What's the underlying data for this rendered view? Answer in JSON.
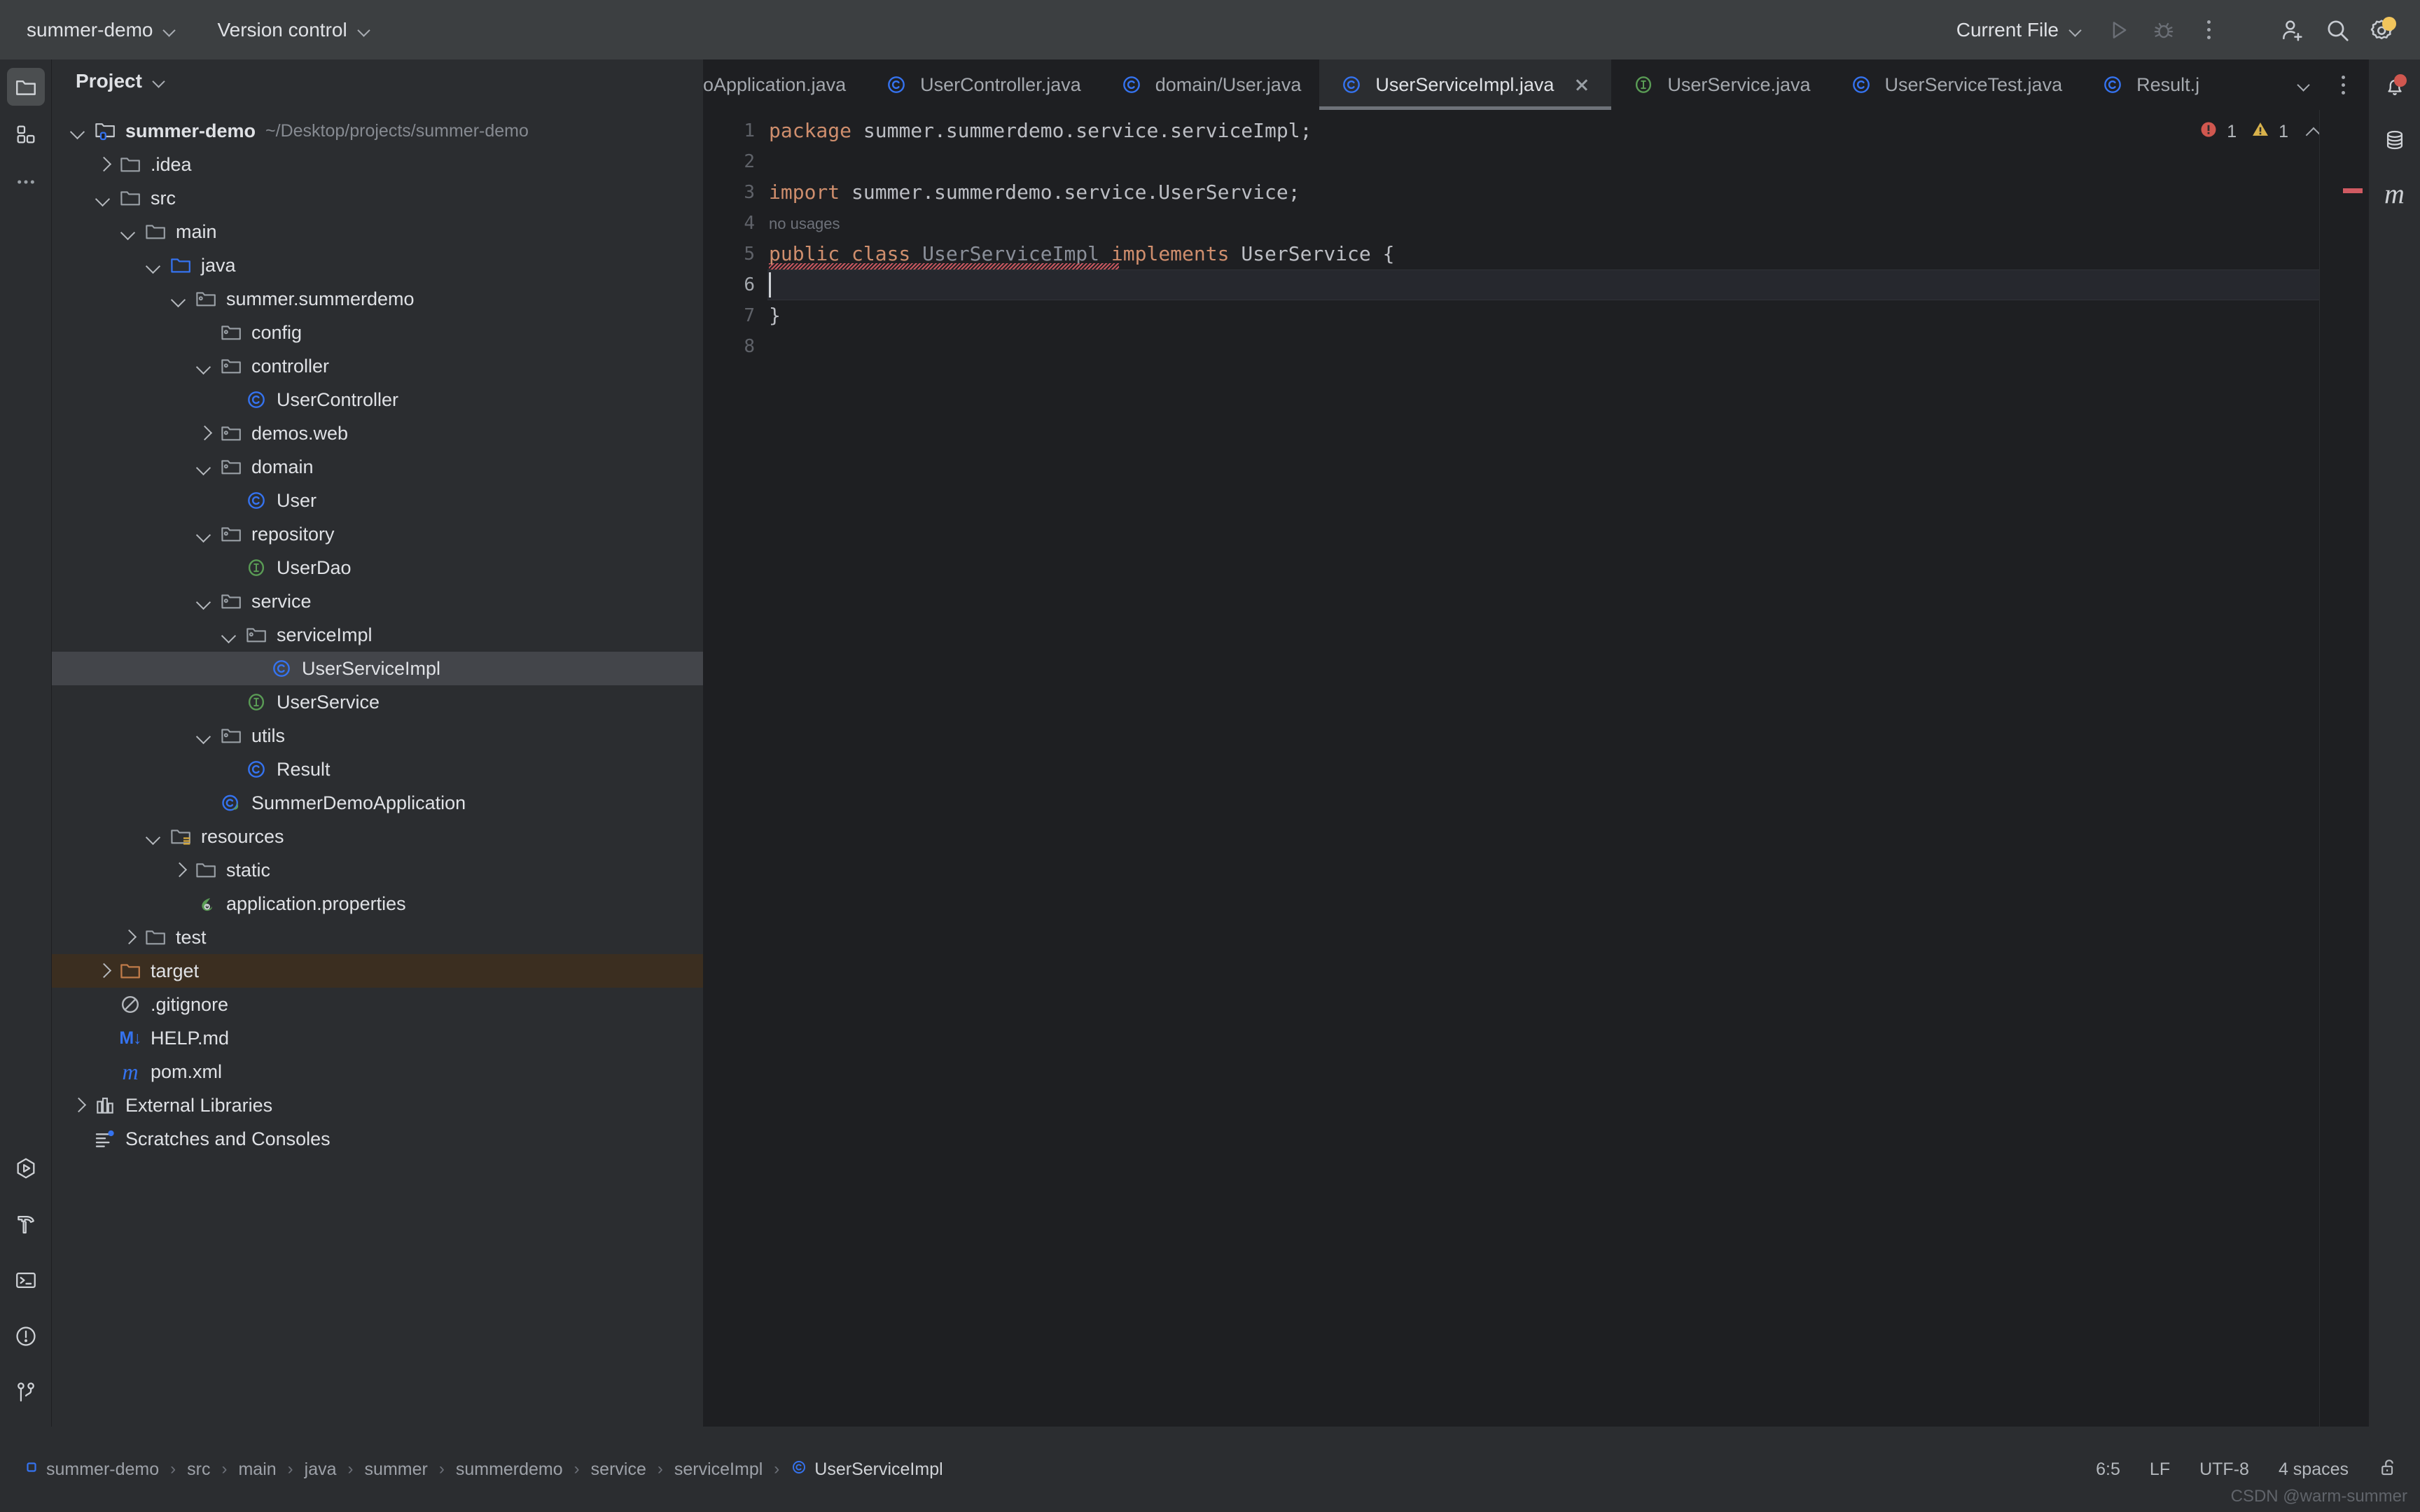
{
  "titlebar": {
    "project_menu": "summer-demo",
    "vcs_menu": "Version control",
    "run_config": "Current File",
    "icons": {
      "run": "run-icon",
      "debug": "debug-icon",
      "more": "more-vertical-icon",
      "add_user": "add-user-icon",
      "search": "search-icon",
      "settings": "settings-gear-icon"
    }
  },
  "left_rail": {
    "top": [
      "project-icon",
      "commit-icon",
      "more-tool-windows-icon"
    ],
    "bottom": [
      "run-tool-icon",
      "build-hammer-icon",
      "terminal-icon",
      "problems-icon",
      "version-control-branch-icon"
    ]
  },
  "right_rail": [
    "notifications-bell-icon",
    "database-icon",
    "maven-icon"
  ],
  "project_panel": {
    "title": "Project",
    "tree": [
      {
        "depth": 0,
        "twisty": "down",
        "icon": "module-folder",
        "label": "summer-demo",
        "bold": true,
        "path": "~/Desktop/projects/summer-demo"
      },
      {
        "depth": 1,
        "twisty": "right",
        "icon": "folder",
        "label": ".idea"
      },
      {
        "depth": 1,
        "twisty": "down",
        "icon": "folder",
        "label": "src"
      },
      {
        "depth": 2,
        "twisty": "down",
        "icon": "folder",
        "label": "main"
      },
      {
        "depth": 3,
        "twisty": "down",
        "icon": "source-folder",
        "label": "java"
      },
      {
        "depth": 4,
        "twisty": "down",
        "icon": "package",
        "label": "summer.summerdemo"
      },
      {
        "depth": 5,
        "twisty": "none",
        "icon": "package",
        "label": "config"
      },
      {
        "depth": 5,
        "twisty": "down",
        "icon": "package",
        "label": "controller"
      },
      {
        "depth": 6,
        "twisty": "none",
        "icon": "class",
        "label": "UserController"
      },
      {
        "depth": 5,
        "twisty": "right",
        "icon": "package",
        "label": "demos.web"
      },
      {
        "depth": 5,
        "twisty": "down",
        "icon": "package",
        "label": "domain"
      },
      {
        "depth": 6,
        "twisty": "none",
        "icon": "class",
        "label": "User"
      },
      {
        "depth": 5,
        "twisty": "down",
        "icon": "package",
        "label": "repository"
      },
      {
        "depth": 6,
        "twisty": "none",
        "icon": "interface",
        "label": "UserDao"
      },
      {
        "depth": 5,
        "twisty": "down",
        "icon": "package",
        "label": "service"
      },
      {
        "depth": 6,
        "twisty": "down",
        "icon": "package",
        "label": "serviceImpl"
      },
      {
        "depth": 7,
        "twisty": "none",
        "icon": "class",
        "label": "UserServiceImpl",
        "selected": true
      },
      {
        "depth": 6,
        "twisty": "none",
        "icon": "interface",
        "label": "UserService"
      },
      {
        "depth": 5,
        "twisty": "down",
        "icon": "package",
        "label": "utils"
      },
      {
        "depth": 6,
        "twisty": "none",
        "icon": "class",
        "label": "Result"
      },
      {
        "depth": 5,
        "twisty": "none",
        "icon": "spring-class",
        "label": "SummerDemoApplication"
      },
      {
        "depth": 3,
        "twisty": "down",
        "icon": "resources-folder",
        "label": "resources"
      },
      {
        "depth": 4,
        "twisty": "right",
        "icon": "folder",
        "label": "static"
      },
      {
        "depth": 4,
        "twisty": "none",
        "icon": "spring-properties",
        "label": "application.properties"
      },
      {
        "depth": 2,
        "twisty": "right",
        "icon": "folder",
        "label": "test"
      },
      {
        "depth": 1,
        "twisty": "right",
        "icon": "excluded-folder",
        "label": "target",
        "highlight": "target"
      },
      {
        "depth": 1,
        "twisty": "none",
        "icon": "gitignore",
        "label": ".gitignore"
      },
      {
        "depth": 1,
        "twisty": "none",
        "icon": "markdown",
        "label": "HELP.md"
      },
      {
        "depth": 1,
        "twisty": "none",
        "icon": "maven",
        "label": "pom.xml"
      },
      {
        "depth": 0,
        "twisty": "right",
        "icon": "libraries",
        "label": "External Libraries"
      },
      {
        "depth": 0,
        "twisty": "none",
        "icon": "scratches",
        "label": "Scratches and Consoles"
      }
    ]
  },
  "editor": {
    "tabs": [
      {
        "label": "oApplication.java",
        "icon": "none",
        "active": false,
        "clipped": true
      },
      {
        "label": "UserController.java",
        "icon": "class",
        "active": false
      },
      {
        "label": "domain/User.java",
        "icon": "class",
        "active": false
      },
      {
        "label": "UserServiceImpl.java",
        "icon": "class",
        "active": true,
        "closable": true
      },
      {
        "label": "UserService.java",
        "icon": "interface",
        "active": false
      },
      {
        "label": "UserServiceTest.java",
        "icon": "class",
        "active": false
      },
      {
        "label": "Result.j",
        "icon": "class",
        "active": false,
        "clipped": true
      }
    ],
    "tab_overflow_icon": "chevron-down-icon",
    "tab_options_icon": "more-vertical-icon",
    "inspections": {
      "error_count": "1",
      "warning_count": "1"
    },
    "lines": [
      {
        "num": "1",
        "tokens": [
          {
            "t": "package",
            "c": "kw"
          },
          {
            "t": " summer.summerdemo.service.serviceImpl;",
            "c": "plain"
          }
        ]
      },
      {
        "num": "2",
        "tokens": []
      },
      {
        "num": "3",
        "tokens": [
          {
            "t": "import",
            "c": "kw"
          },
          {
            "t": " summer.summerdemo.service.UserService;",
            "c": "plain"
          }
        ]
      },
      {
        "num": "4",
        "tokens": []
      },
      {
        "num": "5",
        "tokens": [
          {
            "t": "public class",
            "c": "kw"
          },
          {
            "t": " ",
            "c": "plain"
          },
          {
            "t": "UserServiceImpl",
            "c": "cls"
          },
          {
            "t": " ",
            "c": "plain"
          },
          {
            "t": "implements",
            "c": "kw"
          },
          {
            "t": " UserService {",
            "c": "plain"
          }
        ]
      },
      {
        "num": "6",
        "tokens": []
      },
      {
        "num": "7",
        "tokens": [
          {
            "t": "}",
            "c": "plain"
          }
        ]
      },
      {
        "num": "8",
        "tokens": []
      }
    ],
    "usage_hint": "no usages",
    "current_line": "6"
  },
  "status_bar": {
    "breadcrumb": [
      "summer-demo",
      "src",
      "main",
      "java",
      "summer",
      "summerdemo",
      "service",
      "serviceImpl",
      "UserServiceImpl"
    ],
    "separator": "›",
    "caret_position": "6:5",
    "line_separator": "LF",
    "encoding": "UTF-8",
    "indent": "4 spaces",
    "lock_icon": "unlocked-icon"
  },
  "watermark": "CSDN @warm-summer",
  "colors": {
    "titlebar_bg": "#3c3f41",
    "panel_bg": "#2b2d30",
    "editor_bg": "#1e1f22",
    "selection_bg": "#43454a",
    "target_highlight": "#3b2e20",
    "keyword": "#cf8e6d",
    "class_name": "#8a8f99",
    "text": "#bcbec4",
    "error": "#d05a62",
    "warning": "#d9b24b",
    "accent_blue": "#3573f0",
    "interface_green": "#5a9c55"
  }
}
